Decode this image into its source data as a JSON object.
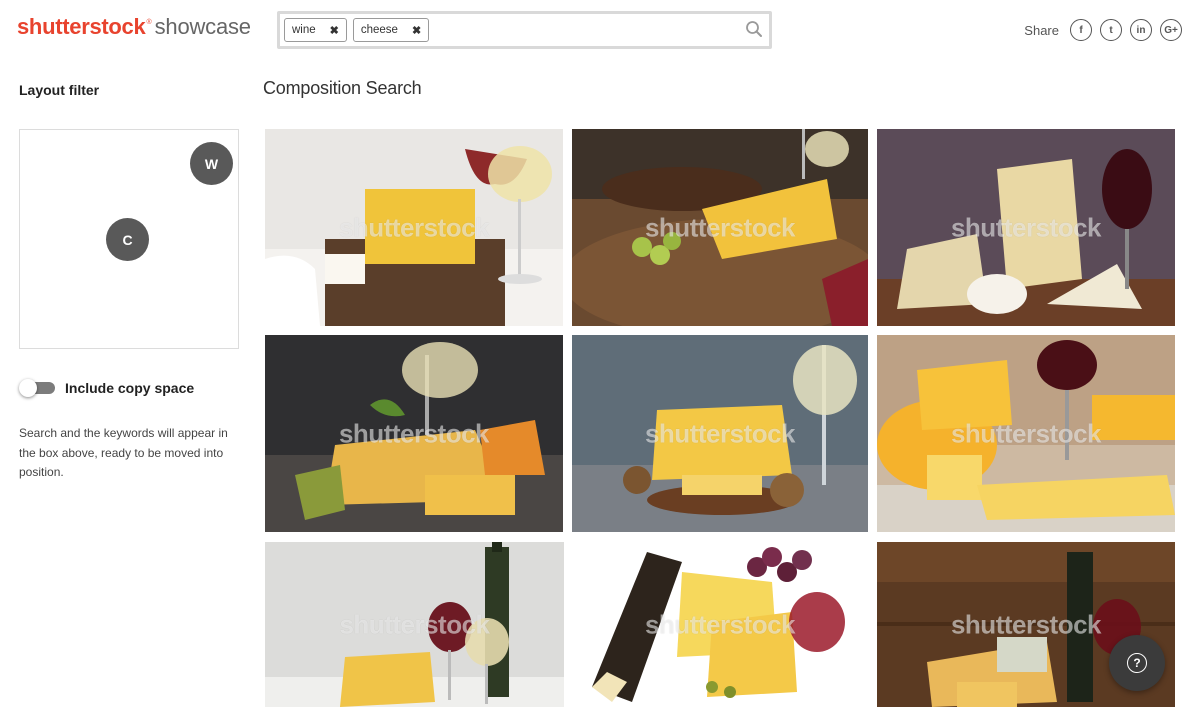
{
  "header": {
    "logo_main": "shutterstock",
    "logo_reg": "®",
    "logo_sub": "showcase",
    "search": {
      "chips": [
        {
          "label": "wine"
        },
        {
          "label": "cheese"
        }
      ],
      "chip_remove_glyph": "✖",
      "icon": "search-icon"
    },
    "share_label": "Share",
    "social": [
      {
        "name": "facebook-icon",
        "glyph": "f"
      },
      {
        "name": "twitter-icon",
        "glyph": "t"
      },
      {
        "name": "linkedin-icon",
        "glyph": "in"
      },
      {
        "name": "google-plus-icon",
        "glyph": "G+"
      }
    ]
  },
  "sidebar": {
    "title": "Layout filter",
    "tokens": {
      "w": "W",
      "c": "C"
    },
    "copy_space": {
      "label": "Include copy space",
      "enabled": false
    },
    "hint": "Search and the keywords will appear in the box above, ready to be moved into position."
  },
  "main": {
    "title": "Composition Search",
    "watermark": "shutterstock"
  },
  "help": {
    "glyph": "?",
    "icon": "help-icon"
  }
}
